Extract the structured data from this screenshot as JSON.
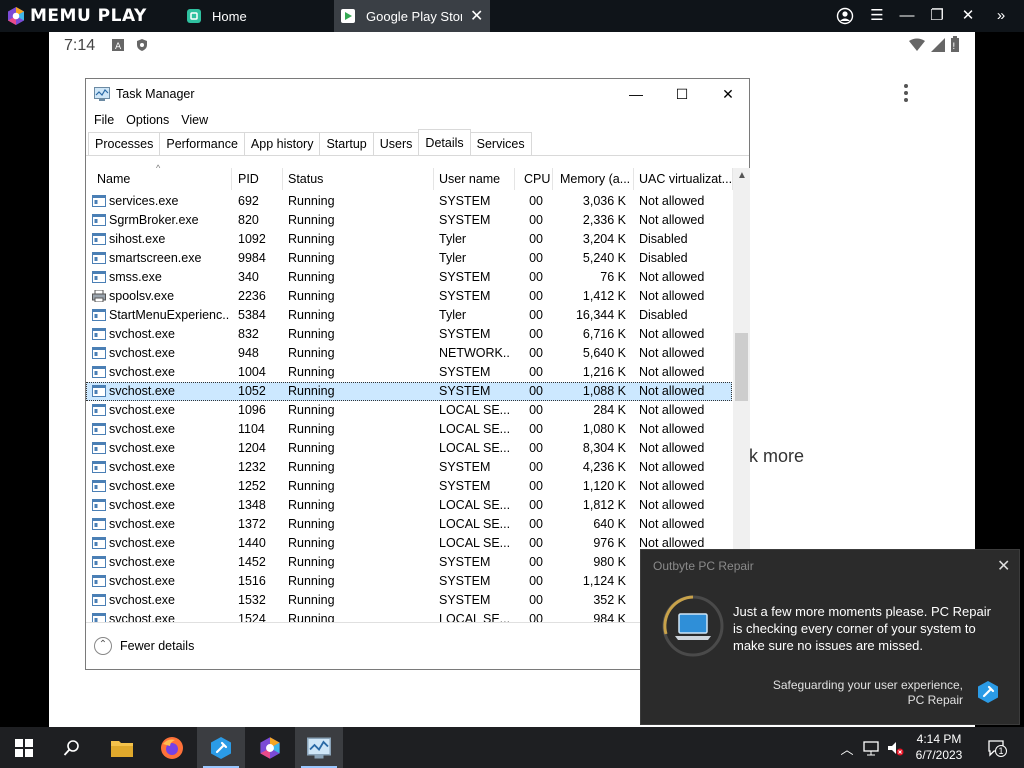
{
  "memu": {
    "brand": "MEMU PLAY",
    "tabs": [
      {
        "label": "Home"
      },
      {
        "label": "Google Play Store"
      }
    ]
  },
  "android": {
    "time": "7:14",
    "partial_text": "k more"
  },
  "task_manager": {
    "title": "Task Manager",
    "menu": [
      "File",
      "Options",
      "View"
    ],
    "tabs": [
      "Processes",
      "Performance",
      "App history",
      "Startup",
      "Users",
      "Details",
      "Services"
    ],
    "active_tab": "Details",
    "columns": [
      "Name",
      "PID",
      "Status",
      "User name",
      "CPU",
      "Memory (a...",
      "UAC virtualizat..."
    ],
    "rows": [
      {
        "name": "services.exe",
        "pid": "692",
        "status": "Running",
        "user": "SYSTEM",
        "cpu": "00",
        "mem": "3,036 K",
        "uac": "Not allowed"
      },
      {
        "name": "SgrmBroker.exe",
        "pid": "820",
        "status": "Running",
        "user": "SYSTEM",
        "cpu": "00",
        "mem": "2,336 K",
        "uac": "Not allowed"
      },
      {
        "name": "sihost.exe",
        "pid": "1092",
        "status": "Running",
        "user": "Tyler",
        "cpu": "00",
        "mem": "3,204 K",
        "uac": "Disabled"
      },
      {
        "name": "smartscreen.exe",
        "pid": "9984",
        "status": "Running",
        "user": "Tyler",
        "cpu": "00",
        "mem": "5,240 K",
        "uac": "Disabled"
      },
      {
        "name": "smss.exe",
        "pid": "340",
        "status": "Running",
        "user": "SYSTEM",
        "cpu": "00",
        "mem": "76 K",
        "uac": "Not allowed"
      },
      {
        "name": "spoolsv.exe",
        "pid": "2236",
        "status": "Running",
        "user": "SYSTEM",
        "cpu": "00",
        "mem": "1,412 K",
        "uac": "Not allowed"
      },
      {
        "name": "StartMenuExperienc...",
        "pid": "5384",
        "status": "Running",
        "user": "Tyler",
        "cpu": "00",
        "mem": "16,344 K",
        "uac": "Disabled"
      },
      {
        "name": "svchost.exe",
        "pid": "832",
        "status": "Running",
        "user": "SYSTEM",
        "cpu": "00",
        "mem": "6,716 K",
        "uac": "Not allowed"
      },
      {
        "name": "svchost.exe",
        "pid": "948",
        "status": "Running",
        "user": "NETWORK...",
        "cpu": "00",
        "mem": "5,640 K",
        "uac": "Not allowed"
      },
      {
        "name": "svchost.exe",
        "pid": "1004",
        "status": "Running",
        "user": "SYSTEM",
        "cpu": "00",
        "mem": "1,216 K",
        "uac": "Not allowed"
      },
      {
        "name": "svchost.exe",
        "pid": "1052",
        "status": "Running",
        "user": "SYSTEM",
        "cpu": "00",
        "mem": "1,088 K",
        "uac": "Not allowed",
        "selected": true
      },
      {
        "name": "svchost.exe",
        "pid": "1096",
        "status": "Running",
        "user": "LOCAL SE...",
        "cpu": "00",
        "mem": "284 K",
        "uac": "Not allowed"
      },
      {
        "name": "svchost.exe",
        "pid": "1104",
        "status": "Running",
        "user": "LOCAL SE...",
        "cpu": "00",
        "mem": "1,080 K",
        "uac": "Not allowed"
      },
      {
        "name": "svchost.exe",
        "pid": "1204",
        "status": "Running",
        "user": "LOCAL SE...",
        "cpu": "00",
        "mem": "8,304 K",
        "uac": "Not allowed"
      },
      {
        "name": "svchost.exe",
        "pid": "1232",
        "status": "Running",
        "user": "SYSTEM",
        "cpu": "00",
        "mem": "4,236 K",
        "uac": "Not allowed"
      },
      {
        "name": "svchost.exe",
        "pid": "1252",
        "status": "Running",
        "user": "SYSTEM",
        "cpu": "00",
        "mem": "1,120 K",
        "uac": "Not allowed"
      },
      {
        "name": "svchost.exe",
        "pid": "1348",
        "status": "Running",
        "user": "LOCAL SE...",
        "cpu": "00",
        "mem": "1,812 K",
        "uac": "Not allowed"
      },
      {
        "name": "svchost.exe",
        "pid": "1372",
        "status": "Running",
        "user": "LOCAL SE...",
        "cpu": "00",
        "mem": "640 K",
        "uac": "Not allowed"
      },
      {
        "name": "svchost.exe",
        "pid": "1440",
        "status": "Running",
        "user": "LOCAL SE...",
        "cpu": "00",
        "mem": "976 K",
        "uac": "Not allowed"
      },
      {
        "name": "svchost.exe",
        "pid": "1452",
        "status": "Running",
        "user": "SYSTEM",
        "cpu": "00",
        "mem": "980 K",
        "uac": ""
      },
      {
        "name": "svchost.exe",
        "pid": "1516",
        "status": "Running",
        "user": "SYSTEM",
        "cpu": "00",
        "mem": "1,124 K",
        "uac": ""
      },
      {
        "name": "svchost.exe",
        "pid": "1532",
        "status": "Running",
        "user": "SYSTEM",
        "cpu": "00",
        "mem": "352 K",
        "uac": ""
      },
      {
        "name": "svchost.exe",
        "pid": "1524",
        "status": "Running",
        "user": "LOCAL SE...",
        "cpu": "00",
        "mem": "984 K",
        "uac": ""
      }
    ],
    "fewer_details": "Fewer details"
  },
  "toast": {
    "app": "Outbyte PC Repair",
    "message": "Just a few more moments please. PC Repair is checking every corner of your system to make sure no issues are missed.",
    "footer": "Safeguarding your user experience,",
    "footer2": "PC Repair"
  },
  "taskbar": {
    "time": "4:14 PM",
    "date": "6/7/2023",
    "notifications": "1"
  },
  "colors": {
    "selection": "#cce8ff",
    "toast_bg": "#2b2b2b",
    "memu_bar": "#0f1419",
    "taskbar": "#1e1f22"
  }
}
